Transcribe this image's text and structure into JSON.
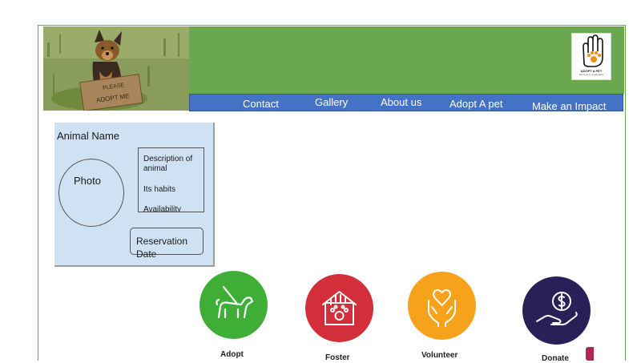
{
  "hero": {
    "sign_line1": "PLEASE",
    "sign_line2": "ADOPT ME"
  },
  "logo": {
    "title": "ADOPT A PET",
    "subtitle": "We trust in small paws"
  },
  "nav": {
    "items": [
      {
        "label": "Contact"
      },
      {
        "label": "Gallery"
      },
      {
        "label": "About us"
      },
      {
        "label": "Adopt A pet"
      },
      {
        "label": "Make an Impact"
      }
    ]
  },
  "wireframe": {
    "title": "Animal Name",
    "photo_label": "Photo",
    "desc1": "Description of",
    "desc2": "animal",
    "habits": "Its habits",
    "availability": "Availability",
    "reservation": "Reservation Date"
  },
  "actions": [
    {
      "label": "Adopt",
      "color": "#3fae37",
      "icon": "dog-leash-icon"
    },
    {
      "label": "Foster",
      "color": "#d32f3a",
      "icon": "pet-house-icon"
    },
    {
      "label": "Volunteer",
      "color": "#f7a21b",
      "icon": "heart-hands-icon"
    },
    {
      "label": "Donate",
      "color": "#2a1f57",
      "icon": "coin-hand-icon"
    }
  ],
  "colors": {
    "header_green": "#6aa84f",
    "nav_blue": "#4472c4",
    "wire_fill": "#cfe2f3"
  }
}
